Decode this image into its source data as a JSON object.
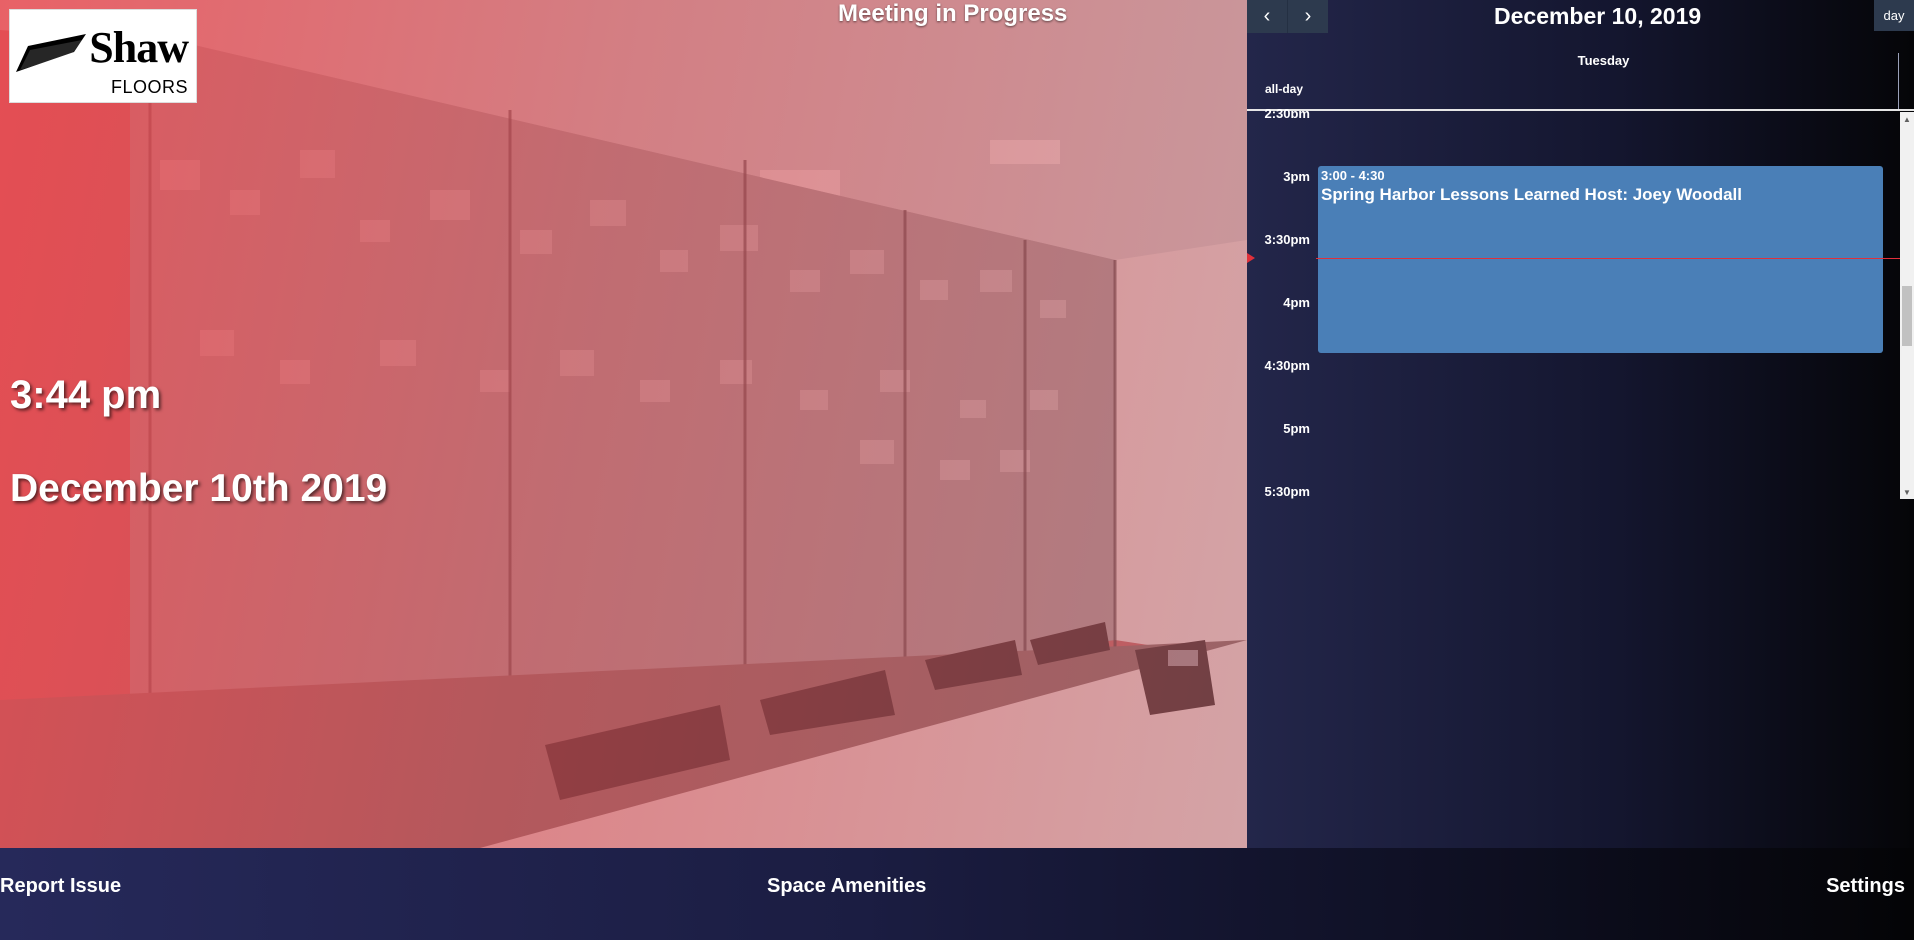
{
  "logo": {
    "word": "Shaw",
    "sub": "FLOORS"
  },
  "status": {
    "title": "Meeting in Progress"
  },
  "clock": {
    "time": "3:44 pm",
    "date": "December 10th 2019"
  },
  "calendar": {
    "prev_icon": "‹",
    "next_icon": "›",
    "title": "December 10, 2019",
    "view_label": "day",
    "day_header": "Tuesday",
    "allday_label": "all-day",
    "time_slots": [
      "2:30pm",
      "3pm",
      "3:30pm",
      "4pm",
      "4:30pm",
      "5pm",
      "5:30pm"
    ],
    "event": {
      "time": "3:00 - 4:30",
      "title": "Spring Harbor Lessons Learned Host: Joey Woodall",
      "color": "#4a7fb7"
    },
    "now_indicator_color": "#e0303a"
  },
  "footer": {
    "report_issue": "Report Issue",
    "space_amenities": "Space Amenities",
    "settings": "Settings"
  },
  "colors": {
    "hero_tint": "#e8484e",
    "panel_bg": "#14162f",
    "nav_button": "#2d3a4e"
  }
}
